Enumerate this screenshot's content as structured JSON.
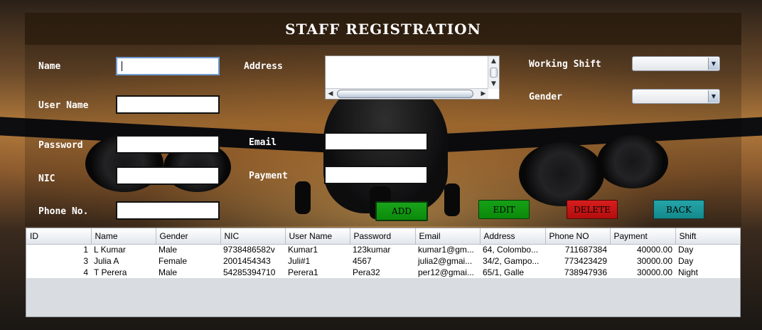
{
  "window": {
    "title": "STAFF REGISTRATION"
  },
  "form": {
    "name_label": "Name",
    "name_value": "",
    "username_label": "User Name",
    "username_value": "",
    "password_label": "Password",
    "password_value": "",
    "nic_label": "NIC",
    "nic_value": "",
    "phone_label": "Phone No.",
    "phone_value": "",
    "address_label": "Address",
    "address_value": "",
    "email_label": "Email",
    "email_value": "",
    "payment_label": "Payment",
    "payment_value": "",
    "shift_label": "Working Shift",
    "shift_value": "",
    "gender_label": "Gender",
    "gender_value": ""
  },
  "buttons": {
    "add": "ADD",
    "edit": "EDIT",
    "delete": "DELETE",
    "back": "BACK"
  },
  "colors": {
    "add": "#0b8a0b",
    "edit": "#0b8a0b",
    "delete": "#c01414",
    "back": "#1a9a9d"
  },
  "table": {
    "columns": [
      "ID",
      "Name",
      "Gender",
      "NIC",
      "User Name",
      "Password",
      "Email",
      "Address",
      "Phone NO",
      "Payment",
      "Shift"
    ],
    "rows": [
      [
        "1",
        "L Kumar",
        "Male",
        "9738486582v",
        "Kumar1",
        "123kumar",
        "kumar1@gm...",
        "64, Colombo...",
        "711687384",
        "40000.00",
        "Day"
      ],
      [
        "3",
        "Julia A",
        "Female",
        "2001454343",
        "Juli#1",
        "4567",
        "julia2@gmai...",
        "34/2, Gampo...",
        "773423429",
        "30000.00",
        "Day"
      ],
      [
        "4",
        "T Perera",
        "Male",
        "54285394710",
        "Perera1",
        "Pera32",
        "per12@gmai...",
        "65/1, Galle",
        "738947936",
        "30000.00",
        "Night"
      ]
    ]
  }
}
